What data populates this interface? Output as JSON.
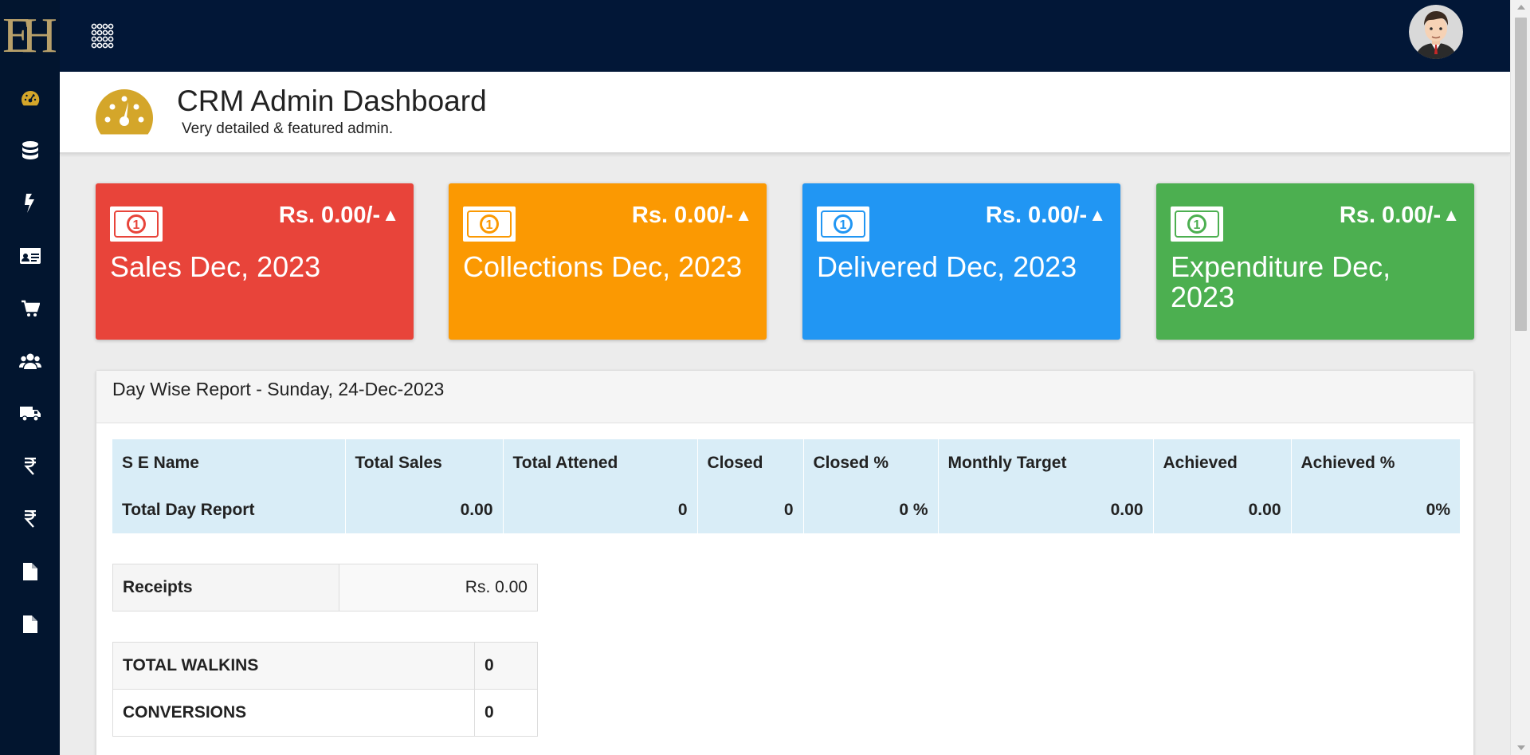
{
  "sidebar": {
    "logo": "EH",
    "items": [
      {
        "name": "dashboard",
        "icon": "dashboard-icon"
      },
      {
        "name": "database",
        "icon": "database-icon"
      },
      {
        "name": "exchange",
        "icon": "exchange-icon"
      },
      {
        "name": "id-card",
        "icon": "id-card-icon"
      },
      {
        "name": "cart",
        "icon": "cart-icon"
      },
      {
        "name": "users",
        "icon": "users-icon"
      },
      {
        "name": "truck",
        "icon": "truck-icon"
      },
      {
        "name": "rupee-1",
        "icon": "rupee-icon"
      },
      {
        "name": "rupee-2",
        "icon": "rupee-icon"
      },
      {
        "name": "file-1",
        "icon": "file-icon"
      },
      {
        "name": "file-2",
        "icon": "file-icon"
      }
    ]
  },
  "header": {
    "title": "CRM Admin Dashboard",
    "subtitle": "Very detailed & featured admin."
  },
  "colors": {
    "sidebar": "#02152f",
    "topbar": "#021737",
    "accent_gold": "#d4a62a",
    "card_sales": "#e8443a",
    "card_collections": "#fb9902",
    "card_delivered": "#2196f3",
    "card_expenditure": "#4caf50"
  },
  "cards": [
    {
      "amount": "Rs. 0.00/-",
      "trend": "▲",
      "label": "Sales Dec, 2023",
      "color": "#e8443a",
      "icon": "money-icon"
    },
    {
      "amount": "Rs. 0.00/-",
      "trend": "▲",
      "label": "Collections Dec, 2023",
      "color": "#fb9902",
      "icon": "money-icon"
    },
    {
      "amount": "Rs. 0.00/-",
      "trend": "▲",
      "label": "Delivered Dec, 2023",
      "color": "#2196f3",
      "icon": "money-icon"
    },
    {
      "amount": "Rs. 0.00/-",
      "trend": "▲",
      "label": "Expenditure Dec, 2023",
      "color": "#4caf50",
      "icon": "money-icon"
    }
  ],
  "report": {
    "title": "Day Wise Report - Sunday, 24-Dec-2023",
    "columns": [
      "S E Name",
      "Total Sales",
      "Total Attened",
      "Closed",
      "Closed %",
      "Monthly Target",
      "Achieved",
      "Achieved %"
    ],
    "row": [
      "Total Day Report",
      "0.00",
      "0",
      "0",
      "0 %",
      "0.00",
      "0.00",
      "0%"
    ]
  },
  "receipts": {
    "label": "Receipts",
    "value": "Rs. 0.00"
  },
  "walkins": [
    {
      "label": "TOTAL WALKINS",
      "value": "0"
    },
    {
      "label": "CONVERSIONS",
      "value": "0"
    }
  ]
}
